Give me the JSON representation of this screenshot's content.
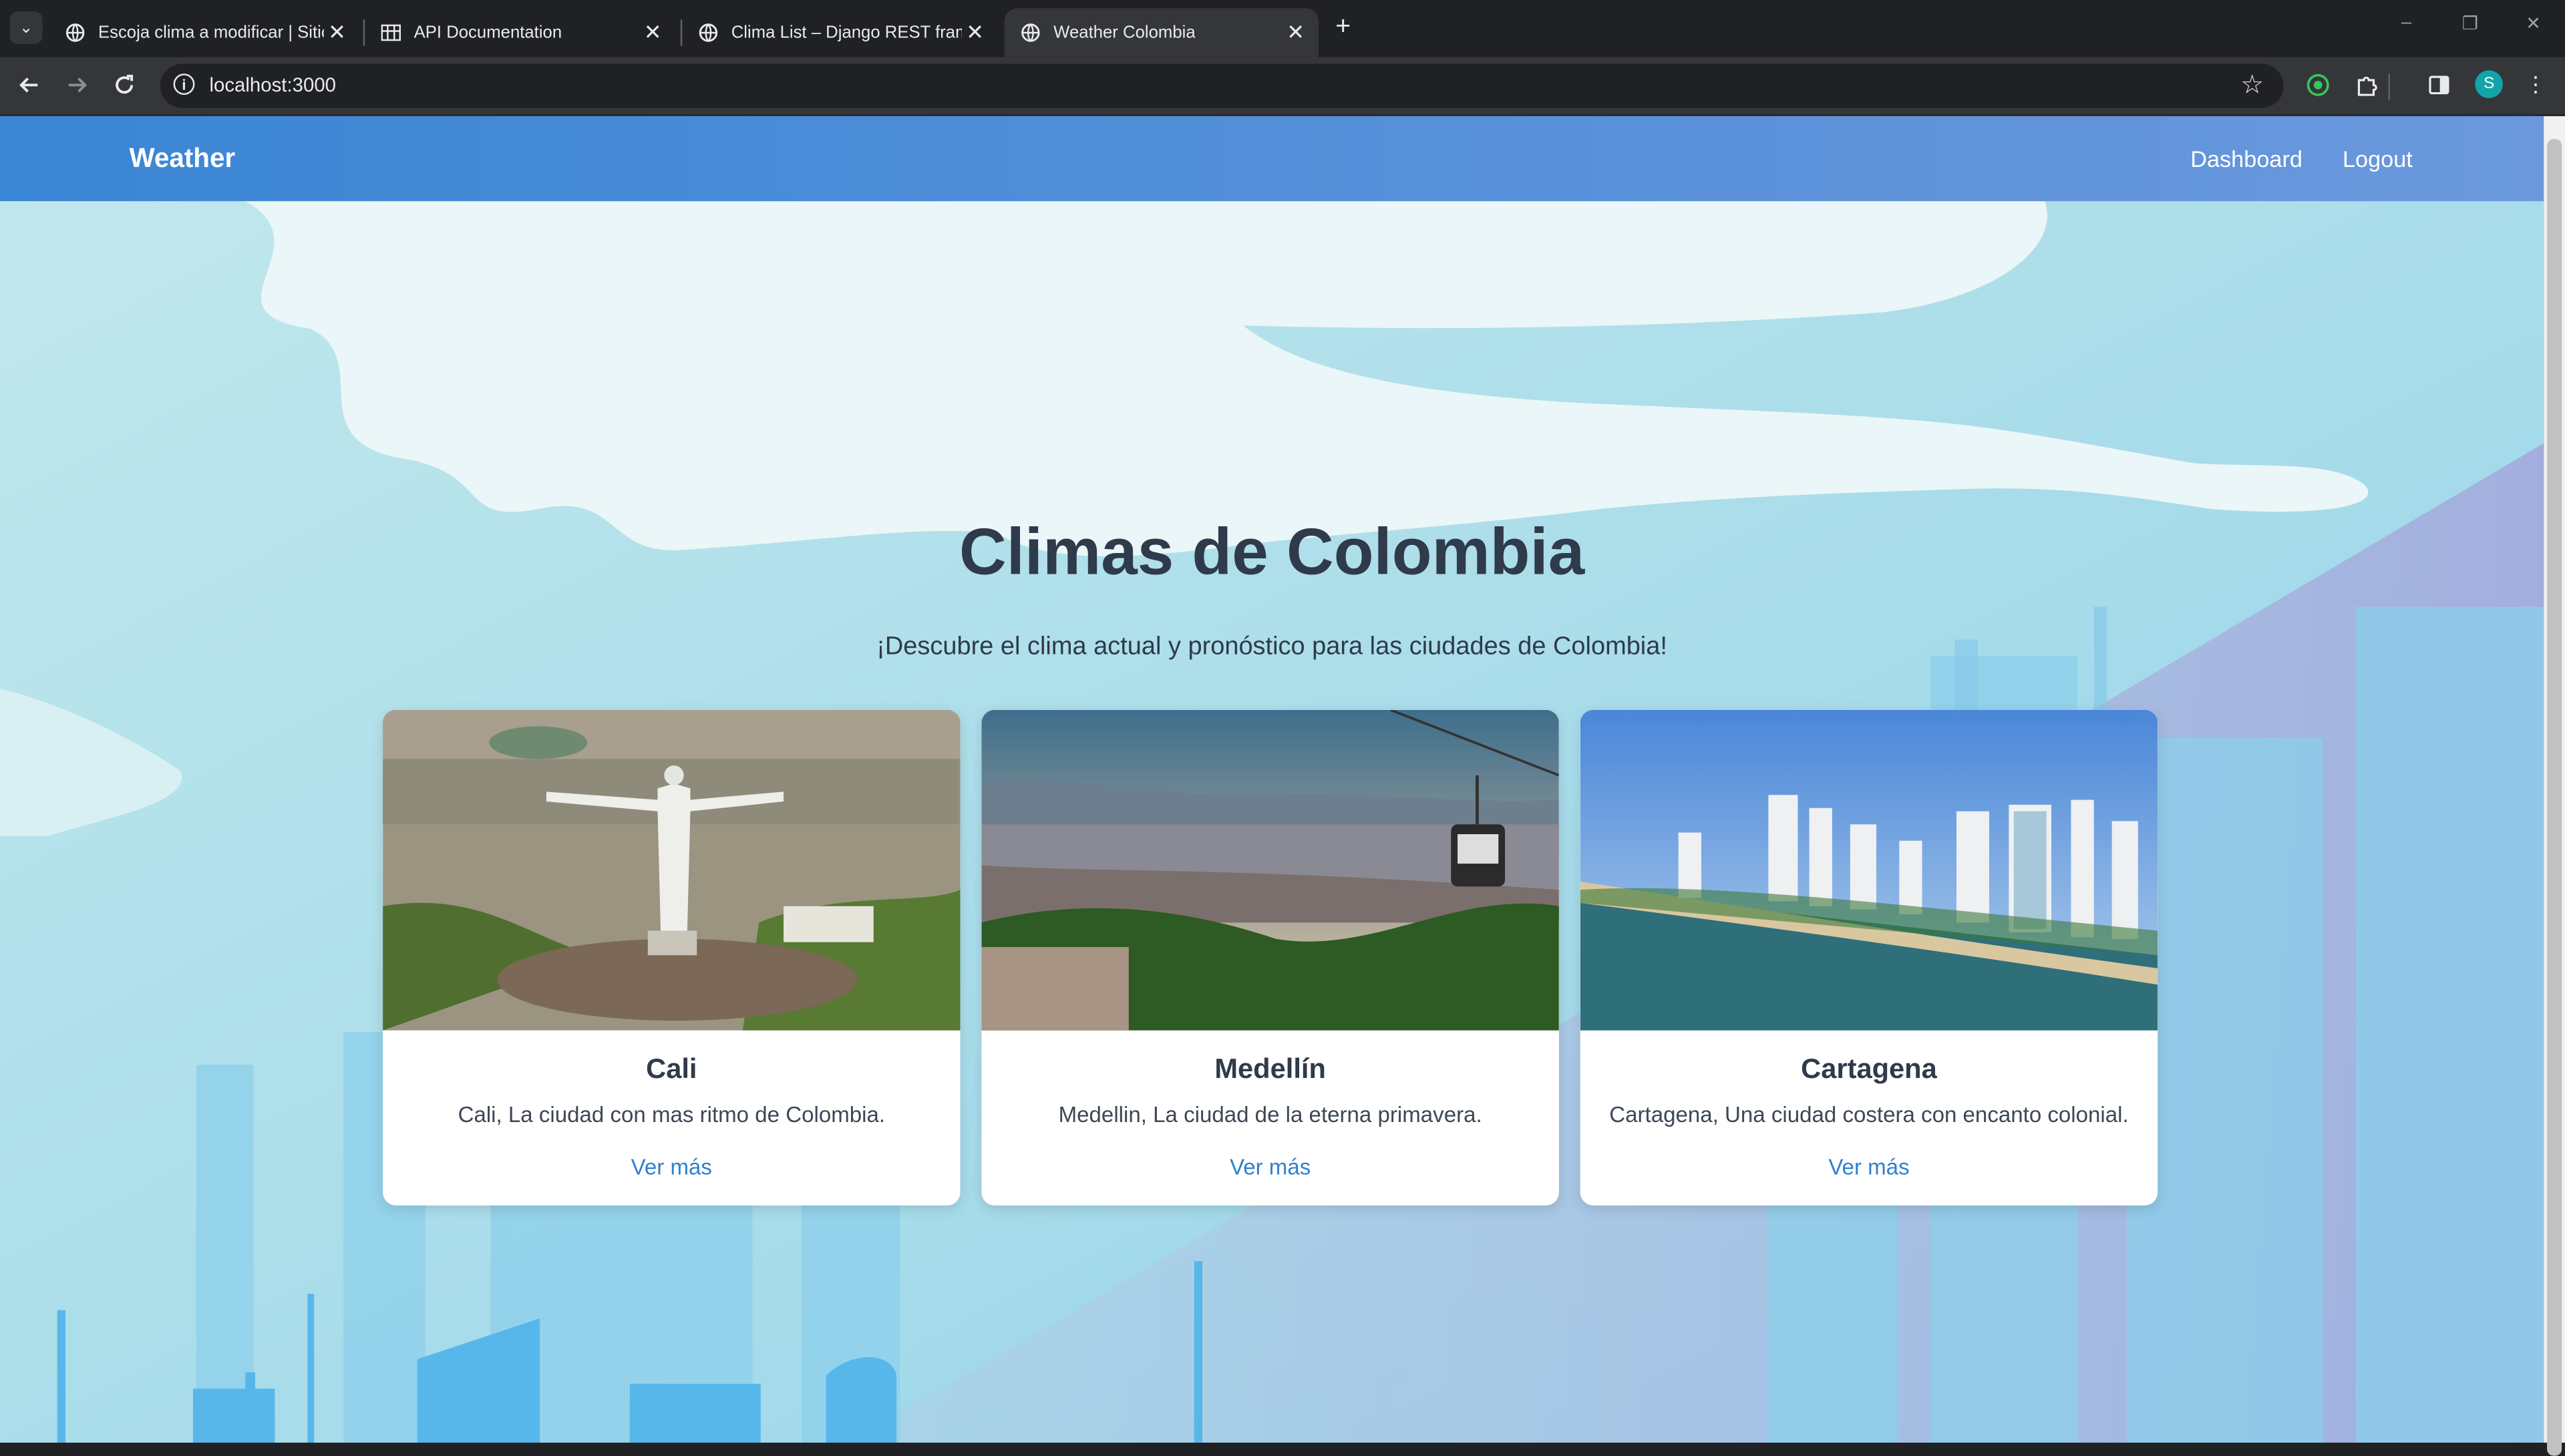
{
  "browser": {
    "tabs": [
      {
        "title": "Escoja clima a modificar | Sitio d",
        "active": false
      },
      {
        "title": "API Documentation",
        "active": false
      },
      {
        "title": "Clima List – Django REST framew",
        "active": false
      },
      {
        "title": "Weather Colombia",
        "active": true
      }
    ],
    "new_tab": "+",
    "url": "localhost:3000",
    "profile_initial": "S",
    "window_controls": [
      "–",
      "❐",
      "✕"
    ]
  },
  "site": {
    "brand": "Weather",
    "nav": [
      "Dashboard",
      "Logout"
    ],
    "title": "Climas de Colombia",
    "subtitle": "¡Descubre el clima actual y pronóstico para las ciudades de Colombia!",
    "cards": [
      {
        "city": "Cali",
        "description": "Cali, La ciudad con mas ritmo de Colombia.",
        "link": "Ver más"
      },
      {
        "city": "Medellín",
        "description": "Medellin, La ciudad de la eterna primavera.",
        "link": "Ver más"
      },
      {
        "city": "Cartagena",
        "description": "Cartagena, Una ciudad costera con encanto colonial.",
        "link": "Ver más"
      }
    ]
  },
  "colors": {
    "navbar_start": "#3a86d4",
    "navbar_end": "#6b98dd",
    "title": "#2f3a4b",
    "link": "#2f80d1",
    "sky": "#a3d8e8"
  },
  "icons": {
    "tab_favicon": "globe-icon",
    "api_favicon": "grid-icon",
    "back": "arrow-left-icon",
    "forward": "arrow-right-icon",
    "reload": "reload-icon",
    "site_info": "info-icon",
    "bookmark": "star-icon",
    "extension": "puzzle-icon",
    "side_panel": "side-panel-icon",
    "menu": "kebab-menu-icon"
  }
}
